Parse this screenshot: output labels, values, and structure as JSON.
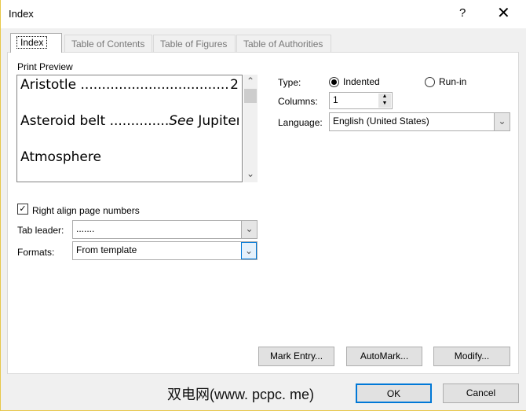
{
  "title": "Index",
  "help": "?",
  "close": "✕",
  "tabs": [
    "Index",
    "Table of Contents",
    "Table of Figures",
    "Table of Authorities"
  ],
  "print_preview_label": "Print Preview",
  "preview": [
    {
      "entry": "Aristotle ...................................",
      "ref": "2",
      "italic": ""
    },
    {
      "entry": "Asteroid belt ..............",
      "ref": " Jupiter",
      "italic": "See"
    },
    {
      "entry": "Atmosphere",
      "ref": "",
      "italic": ""
    }
  ],
  "type_label": "Type:",
  "type_options": [
    "Indented",
    "Run-in"
  ],
  "type_selected": "Indented",
  "columns_label": "Columns:",
  "columns_value": "1",
  "language_label": "Language:",
  "language_value": "English (United States)",
  "right_align_label": "Right align page numbers",
  "right_align_checked": true,
  "tab_leader_label": "Tab leader:",
  "tab_leader_value": ".......",
  "formats_label": "Formats:",
  "formats_value": "From template",
  "buttons": {
    "mark_entry": "Mark Entry...",
    "automark": "AutoMark...",
    "modify": "Modify...",
    "ok": "OK",
    "cancel": "Cancel"
  },
  "watermark": "双电网(www. pcpc. me)"
}
